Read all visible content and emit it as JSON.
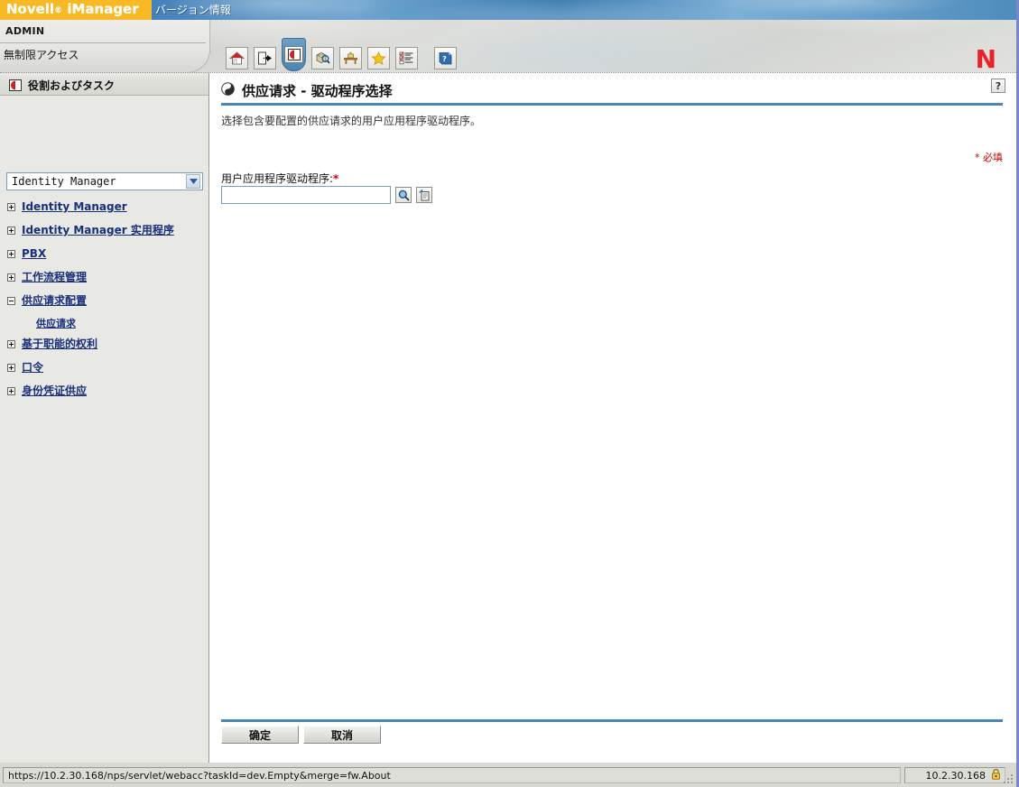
{
  "banner": {
    "brand_novell": "Novell",
    "brand_reg": "®",
    "brand_product": "iManager",
    "version_tab": "バージョン情報"
  },
  "header": {
    "user": "ADMIN",
    "access_level": "無制限アクセス",
    "logo_letter": "N"
  },
  "toolbar": {
    "items": [
      {
        "name": "home-icon",
        "title": "Home"
      },
      {
        "name": "exit-icon",
        "title": "Exit"
      },
      {
        "name": "roles-and-tasks-icon",
        "title": "Roles and Tasks",
        "selected": true
      },
      {
        "name": "object-view-icon",
        "title": "View Objects"
      },
      {
        "name": "configure-icon",
        "title": "Configure"
      },
      {
        "name": "favorites-star-icon",
        "title": "Favorites"
      },
      {
        "name": "checklist-icon",
        "title": "Collection Owner"
      },
      {
        "name": "help-book-icon",
        "title": "Help"
      }
    ]
  },
  "sidebar": {
    "title": "役割およびタスク",
    "title_icon": "roles-and-tasks-icon",
    "filter_value": "Identity Manager",
    "items": [
      {
        "label": "Identity Manager",
        "expanded": false
      },
      {
        "label": "Identity Manager 实用程序",
        "expanded": false
      },
      {
        "label": "PBX",
        "expanded": false
      },
      {
        "label": "工作流程管理",
        "expanded": false
      },
      {
        "label": "供应请求配置",
        "expanded": true,
        "children": [
          {
            "label": "供应请求"
          }
        ]
      },
      {
        "label": "基于职能的权利",
        "expanded": false
      },
      {
        "label": "口令",
        "expanded": false
      },
      {
        "label": "身份凭证供应",
        "expanded": false
      }
    ]
  },
  "content": {
    "title": "供应请求 - 驱动程序选择",
    "title_icon": "task-circle-icon",
    "help_label": "?",
    "description": "选择包含要配置的供应请求的用户应用程序驱动程序。",
    "required_note": "* 必填",
    "field_label": "用户应用程序驱动程序:",
    "field_required_mark": "*",
    "field_value": "",
    "field_placeholder": "",
    "object_selector_icon": "magnifier-icon",
    "object_history_icon": "history-list-icon",
    "ok_label": "确定",
    "cancel_label": "取消"
  },
  "statusbar": {
    "url": "https://10.2.30.168/nps/servlet/webacc?taskId=dev.Empty&merge=fw.About",
    "zone": "10.2.30.168",
    "lock_icon": "padlock-icon"
  },
  "colors": {
    "brand_orange": "#f9b924",
    "banner_blue": "#4d87bd",
    "accent_rule": "#4a87b8",
    "link": "#1a2f7a",
    "required_red": "#cc0000",
    "logo_red": "#e8212b",
    "chrome_gray": "#d9d9d4"
  }
}
